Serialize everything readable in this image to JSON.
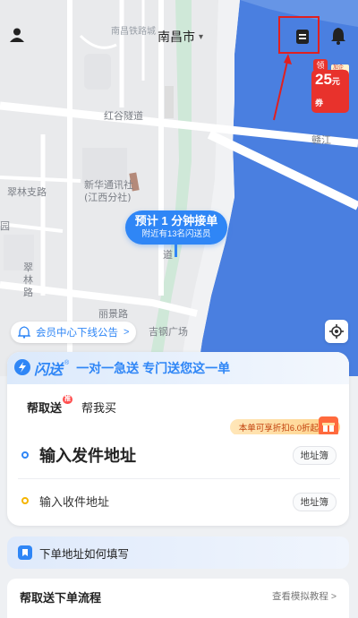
{
  "header": {
    "city": "南昌市",
    "city_chevron": "▾"
  },
  "map": {
    "labels": {
      "top_road": "南昌铁路城",
      "tunnel": "红谷隧道",
      "river": "赣江",
      "poi_line1": "新华通讯社",
      "poi_line2": "(江西分社)",
      "road_left1": "翠林支路",
      "road_left2": "园",
      "road_left3": "翠",
      "road_left4": "林",
      "road_left5": "路",
      "road_bottom": "丽景路",
      "road_bottom2": "吉钢广场",
      "road_mid": "道"
    },
    "bubble": {
      "line1": "预计 1 分钟接单",
      "line2": "附近有13名闪送员"
    }
  },
  "coupon": {
    "lead": "领",
    "amount": "25",
    "unit": "元券",
    "tag": "加企业"
  },
  "notice": {
    "text": "会员中心下线公告",
    "arrow": ">"
  },
  "service_card": {
    "brand": "闪送",
    "reg": "®",
    "slogan": "一对一急送 专门送您这一单",
    "tabs": [
      {
        "label": "帮取送",
        "badge": "推"
      },
      {
        "label": "帮我买"
      }
    ],
    "discount": "本单可享折扣6.0折起",
    "send": {
      "label": "输入发件地址",
      "book": "地址簿"
    },
    "receive": {
      "label": "输入收件地址",
      "book": "地址簿"
    }
  },
  "guide": {
    "text": "下单地址如何填写"
  },
  "process": {
    "title": "帮取送下单流程",
    "link": "查看模拟教程 >"
  },
  "colors": {
    "accent": "#2f86f6",
    "annotation_red": "#e02020",
    "tab_highlight": "#ffd84a",
    "river": "#4a7fe0"
  },
  "icons": [
    "user-icon",
    "order-list-icon",
    "bell-icon",
    "locate-icon",
    "bolt-icon",
    "gift-icon",
    "guide-icon",
    "speaker-icon"
  ]
}
